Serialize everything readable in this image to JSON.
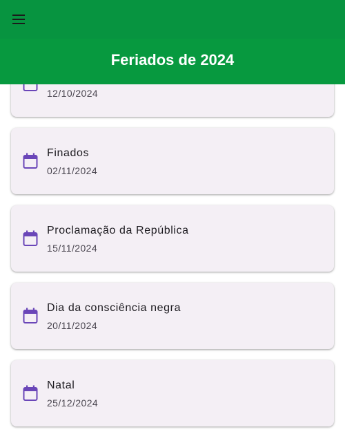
{
  "appbar": {
    "title": "Feriados de 2024",
    "color": "#07993f"
  },
  "holidays": [
    {
      "name": "",
      "date": "12/10/2024"
    },
    {
      "name": "Finados",
      "date": "02/11/2024"
    },
    {
      "name": "Proclamação da República",
      "date": "15/11/2024"
    },
    {
      "name": "Dia da consciência negra",
      "date": "20/11/2024"
    },
    {
      "name": "Natal",
      "date": "25/12/2024"
    }
  ],
  "icon_color": "#6a46b8"
}
